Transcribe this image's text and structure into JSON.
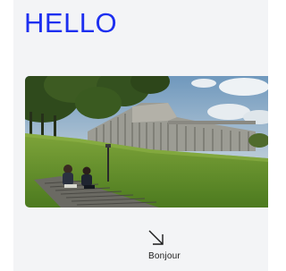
{
  "heading": {
    "text": "HELLO"
  },
  "hero_image": {
    "subject": "students-sitting-on-steps-in-front-of-campus-building",
    "accent_color": "#1d2ff0"
  },
  "link": {
    "icon": "arrow-down-right-icon",
    "label": "Bonjour"
  }
}
